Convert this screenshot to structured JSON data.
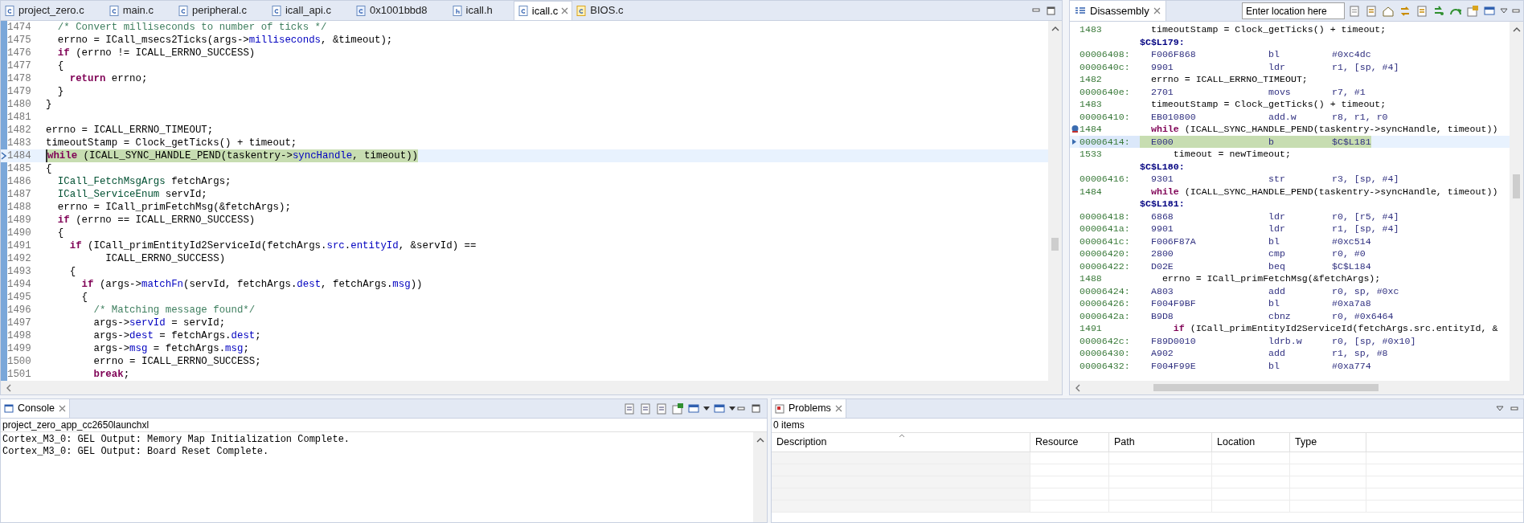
{
  "editor": {
    "tabs": [
      {
        "label": "project_zero.c",
        "kind": "c",
        "selected": false,
        "closable": false
      },
      {
        "label": "main.c",
        "kind": "c",
        "selected": false,
        "closable": false
      },
      {
        "label": "peripheral.c",
        "kind": "c",
        "selected": false,
        "closable": false
      },
      {
        "label": "icall_api.c",
        "kind": "c",
        "selected": false,
        "closable": false
      },
      {
        "label": "0x1001bbd8",
        "kind": "address",
        "selected": false,
        "closable": false
      },
      {
        "label": "icall.h",
        "kind": "h",
        "selected": false,
        "closable": false
      },
      {
        "label": "icall.c",
        "kind": "c",
        "selected": true,
        "closable": true
      },
      {
        "label": "BIOS.c",
        "kind": "bios",
        "selected": false,
        "closable": false
      }
    ],
    "lines": [
      {
        "number": "1474",
        "current": false,
        "segments": [
          {
            "kind": "comment",
            "text": "  /* Convert milliseconds to number of ticks */"
          }
        ]
      },
      {
        "number": "1475",
        "current": false,
        "segments": [
          {
            "kind": "plain",
            "text": "  errno = ICall_msecs2Ticks(args->"
          },
          {
            "kind": "field",
            "text": "milliseconds"
          },
          {
            "kind": "plain",
            "text": ", &timeout);"
          }
        ]
      },
      {
        "number": "1476",
        "current": false,
        "segments": [
          {
            "kind": "keyword",
            "text": "  if"
          },
          {
            "kind": "plain",
            "text": " (errno != ICALL_ERRNO_SUCCESS)"
          }
        ]
      },
      {
        "number": "1477",
        "current": false,
        "segments": [
          {
            "kind": "plain",
            "text": "  {"
          }
        ]
      },
      {
        "number": "1478",
        "current": false,
        "segments": [
          {
            "kind": "keyword",
            "text": "    return"
          },
          {
            "kind": "plain",
            "text": " errno;"
          }
        ]
      },
      {
        "number": "1479",
        "current": false,
        "segments": [
          {
            "kind": "plain",
            "text": "  }"
          }
        ]
      },
      {
        "number": "1480",
        "current": false,
        "segments": [
          {
            "kind": "plain",
            "text": "}"
          }
        ]
      },
      {
        "number": "1481",
        "current": false
      },
      {
        "number": "1482",
        "current": false,
        "segments": [
          {
            "kind": "plain",
            "text": "errno = ICALL_ERRNO_TIMEOUT;"
          }
        ]
      },
      {
        "number": "1483",
        "current": false,
        "segments": [
          {
            "kind": "plain",
            "text": "timeoutStamp = Clock_getTicks() + timeout;"
          }
        ]
      },
      {
        "number": "1484",
        "current": true,
        "segments": [
          {
            "kind": "keyword",
            "text": "while"
          },
          {
            "kind": "plain",
            "text": " (ICALL_SYNC_HANDLE_PEND(taskentry->"
          },
          {
            "kind": "field",
            "text": "syncHandle"
          },
          {
            "kind": "plain",
            "text": ", timeout))"
          }
        ]
      },
      {
        "number": "1485",
        "current": false,
        "segments": [
          {
            "kind": "plain",
            "text": "{"
          }
        ]
      },
      {
        "number": "1486",
        "current": false,
        "segments": [
          {
            "kind": "type",
            "text": "  ICall_FetchMsgArgs"
          },
          {
            "kind": "plain",
            "text": " fetchArgs;"
          }
        ]
      },
      {
        "number": "1487",
        "current": false,
        "segments": [
          {
            "kind": "type",
            "text": "  ICall_ServiceEnum"
          },
          {
            "kind": "plain",
            "text": " servId;"
          }
        ]
      },
      {
        "number": "1488",
        "current": false,
        "segments": [
          {
            "kind": "plain",
            "text": "  errno = ICall_primFetchMsg(&fetchArgs);"
          }
        ]
      },
      {
        "number": "1489",
        "current": false,
        "segments": [
          {
            "kind": "keyword",
            "text": "  if"
          },
          {
            "kind": "plain",
            "text": " (errno == ICALL_ERRNO_SUCCESS)"
          }
        ]
      },
      {
        "number": "1490",
        "current": false,
        "segments": [
          {
            "kind": "plain",
            "text": "  {"
          }
        ]
      },
      {
        "number": "1491",
        "current": false,
        "segments": [
          {
            "kind": "keyword",
            "text": "    if"
          },
          {
            "kind": "plain",
            "text": " (ICall_primEntityId2ServiceId(fetchArgs."
          },
          {
            "kind": "field",
            "text": "src"
          },
          {
            "kind": "plain",
            "text": "."
          },
          {
            "kind": "field",
            "text": "entityId"
          },
          {
            "kind": "plain",
            "text": ", &servId) =="
          }
        ]
      },
      {
        "number": "1492",
        "current": false,
        "segments": [
          {
            "kind": "plain",
            "text": "          ICALL_ERRNO_SUCCESS)"
          }
        ]
      },
      {
        "number": "1493",
        "current": false,
        "segments": [
          {
            "kind": "plain",
            "text": "    {"
          }
        ]
      },
      {
        "number": "1494",
        "current": false,
        "segments": [
          {
            "kind": "keyword",
            "text": "      if"
          },
          {
            "kind": "plain",
            "text": " (args->"
          },
          {
            "kind": "field",
            "text": "matchFn"
          },
          {
            "kind": "plain",
            "text": "(servId, fetchArgs."
          },
          {
            "kind": "field",
            "text": "dest"
          },
          {
            "kind": "plain",
            "text": ", fetchArgs."
          },
          {
            "kind": "field",
            "text": "msg"
          },
          {
            "kind": "plain",
            "text": "))"
          }
        ]
      },
      {
        "number": "1495",
        "current": false,
        "segments": [
          {
            "kind": "plain",
            "text": "      {"
          }
        ]
      },
      {
        "number": "1496",
        "current": false,
        "segments": [
          {
            "kind": "comment",
            "text": "        /* Matching message found*/"
          }
        ]
      },
      {
        "number": "1497",
        "current": false,
        "segments": [
          {
            "kind": "plain",
            "text": "        args->"
          },
          {
            "kind": "field",
            "text": "servId"
          },
          {
            "kind": "plain",
            "text": " = servId;"
          }
        ]
      },
      {
        "number": "1498",
        "current": false,
        "segments": [
          {
            "kind": "plain",
            "text": "        args->"
          },
          {
            "kind": "field",
            "text": "dest"
          },
          {
            "kind": "plain",
            "text": " = fetchArgs."
          },
          {
            "kind": "field",
            "text": "dest"
          },
          {
            "kind": "plain",
            "text": ";"
          }
        ]
      },
      {
        "number": "1499",
        "current": false,
        "segments": [
          {
            "kind": "plain",
            "text": "        args->"
          },
          {
            "kind": "field",
            "text": "msg"
          },
          {
            "kind": "plain",
            "text": " = fetchArgs."
          },
          {
            "kind": "field",
            "text": "msg"
          },
          {
            "kind": "plain",
            "text": ";"
          }
        ]
      },
      {
        "number": "1500",
        "current": false,
        "segments": [
          {
            "kind": "plain",
            "text": "        errno = ICALL_ERRNO_SUCCESS;"
          }
        ]
      },
      {
        "number": "1501",
        "current": false,
        "segments": [
          {
            "kind": "keyword",
            "text": "        break"
          },
          {
            "kind": "plain",
            "text": ";"
          }
        ]
      }
    ]
  },
  "disassembly": {
    "title": "Disassembly",
    "location": {
      "placeholder": "Enter location here"
    },
    "rows": [
      {
        "kind": "source",
        "number": "1483",
        "breakpoint": false,
        "segments": [
          {
            "kind": "plain",
            "text": "timeoutStamp = Clock_getTicks() + timeout;"
          }
        ]
      },
      {
        "kind": "label",
        "text": "$C$L179:"
      },
      {
        "kind": "instruction",
        "address": "00006408:",
        "opcode": "F006F868",
        "mnemonic": "bl",
        "operands": "#0xc4dc",
        "current": false
      },
      {
        "kind": "instruction",
        "address": "0000640c:",
        "opcode": "9901",
        "mnemonic": "ldr",
        "operands": "r1, [sp, #4]",
        "current": false
      },
      {
        "kind": "source",
        "number": "1482",
        "breakpoint": false,
        "segments": [
          {
            "kind": "plain",
            "text": "errno = ICALL_ERRNO_TIMEOUT;"
          }
        ]
      },
      {
        "kind": "instruction",
        "address": "0000640e:",
        "opcode": "2701",
        "mnemonic": "movs",
        "operands": "r7, #1",
        "current": false
      },
      {
        "kind": "source",
        "number": "1483",
        "breakpoint": false,
        "segments": [
          {
            "kind": "plain",
            "text": "timeoutStamp = Clock_getTicks() + timeout;"
          }
        ]
      },
      {
        "kind": "instruction",
        "address": "00006410:",
        "opcode": "EB010800",
        "mnemonic": "add.w",
        "operands": "r8, r1, r0",
        "current": false
      },
      {
        "kind": "source",
        "number": "1484",
        "breakpoint": true,
        "segments": [
          {
            "kind": "keyword",
            "text": "while"
          },
          {
            "kind": "plain",
            "text": " (ICALL_SYNC_HANDLE_PEND(taskentry->syncHandle, timeout))"
          }
        ]
      },
      {
        "kind": "instruction",
        "address": "00006414:",
        "opcode": "E000",
        "mnemonic": "b",
        "operands": "$C$L181",
        "current": true
      },
      {
        "kind": "source",
        "number": "1533",
        "breakpoint": false,
        "segments": [
          {
            "kind": "plain",
            "text": "    timeout = newTimeout;"
          }
        ]
      },
      {
        "kind": "label",
        "text": "$C$L180:"
      },
      {
        "kind": "instruction",
        "address": "00006416:",
        "opcode": "9301",
        "mnemonic": "str",
        "operands": "r3, [sp, #4]",
        "current": false
      },
      {
        "kind": "source",
        "number": "1484",
        "breakpoint": false,
        "segments": [
          {
            "kind": "keyword",
            "text": "while"
          },
          {
            "kind": "plain",
            "text": " (ICALL_SYNC_HANDLE_PEND(taskentry->syncHandle, timeout))"
          }
        ]
      },
      {
        "kind": "label",
        "text": "$C$L181:"
      },
      {
        "kind": "instruction",
        "address": "00006418:",
        "opcode": "6868",
        "mnemonic": "ldr",
        "operands": "r0, [r5, #4]",
        "current": false
      },
      {
        "kind": "instruction",
        "address": "0000641a:",
        "opcode": "9901",
        "mnemonic": "ldr",
        "operands": "r1, [sp, #4]",
        "current": false
      },
      {
        "kind": "instruction",
        "address": "0000641c:",
        "opcode": "F006F87A",
        "mnemonic": "bl",
        "operands": "#0xc514",
        "current": false
      },
      {
        "kind": "instruction",
        "address": "00006420:",
        "opcode": "2800",
        "mnemonic": "cmp",
        "operands": "r0, #0",
        "current": false
      },
      {
        "kind": "instruction",
        "address": "00006422:",
        "opcode": "D02E",
        "mnemonic": "beq",
        "operands": "$C$L184",
        "current": false
      },
      {
        "kind": "source",
        "number": "1488",
        "breakpoint": false,
        "segments": [
          {
            "kind": "plain",
            "text": "  errno = ICall_primFetchMsg(&fetchArgs);"
          }
        ]
      },
      {
        "kind": "instruction",
        "address": "00006424:",
        "opcode": "A803",
        "mnemonic": "add",
        "operands": "r0, sp, #0xc",
        "current": false
      },
      {
        "kind": "instruction",
        "address": "00006426:",
        "opcode": "F004F9BF",
        "mnemonic": "bl",
        "operands": "#0xa7a8",
        "current": false
      },
      {
        "kind": "instruction",
        "address": "0000642a:",
        "opcode": "B9D8",
        "mnemonic": "cbnz",
        "operands": "r0, #0x6464",
        "current": false
      },
      {
        "kind": "source",
        "number": "1491",
        "breakpoint": false,
        "segments": [
          {
            "kind": "keyword",
            "text": "    if"
          },
          {
            "kind": "plain",
            "text": " (ICall_primEntityId2ServiceId(fetchArgs.src.entityId, &"
          }
        ]
      },
      {
        "kind": "instruction",
        "address": "0000642c:",
        "opcode": "F89D0010",
        "mnemonic": "ldrb.w",
        "operands": "r0, [sp, #0x10]",
        "current": false
      },
      {
        "kind": "instruction",
        "address": "00006430:",
        "opcode": "A902",
        "mnemonic": "add",
        "operands": "r1, sp, #8",
        "current": false
      },
      {
        "kind": "instruction",
        "address": "00006432:",
        "opcode": "F004F99E",
        "mnemonic": "bl",
        "operands": "#0xa774",
        "current": false
      }
    ]
  },
  "console": {
    "title": "Console",
    "session": "project_zero_app_cc2650launchxl",
    "lines": [
      "Cortex_M3_0: GEL Output: Memory Map Initialization Complete.",
      "Cortex_M3_0: GEL Output: Board Reset Complete."
    ]
  },
  "problems": {
    "title": "Problems",
    "summary": "0 items",
    "columns": [
      "Description",
      "Resource",
      "Path",
      "Location",
      "Type"
    ]
  }
}
